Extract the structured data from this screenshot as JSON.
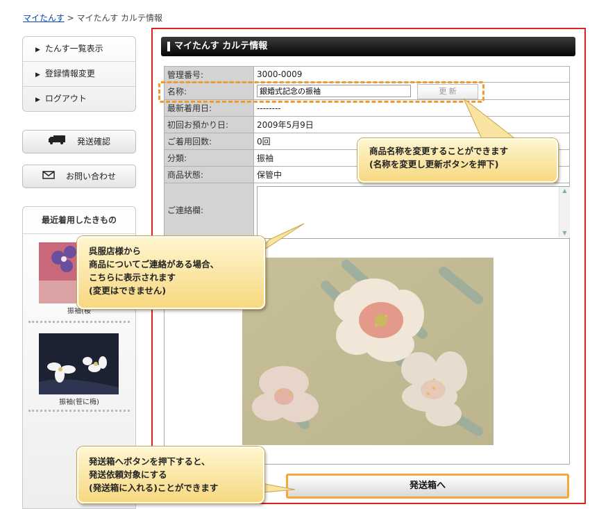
{
  "breadcrumb": {
    "home_link": "マイたんす",
    "separator": ">",
    "current": "マイたんす カルテ情報"
  },
  "sidebar": {
    "menu": [
      {
        "label": "たんす一覧表示"
      },
      {
        "label": "登録情報変更"
      },
      {
        "label": "ログアウト"
      }
    ],
    "shipping_confirm": "発送確認",
    "contact": "お問い合わせ",
    "recent": {
      "title": "最近着用したきもの",
      "items": [
        {
          "caption": "振袖(桜"
        },
        {
          "caption": "振袖(笹に梅)"
        }
      ]
    }
  },
  "page_title": "マイたんす カルテ情報",
  "details": {
    "management_no": {
      "label": "管理番号:",
      "value": "3000-0009"
    },
    "name": {
      "label": "名称:",
      "value": "銀婚式記念の振袖",
      "update_button": "更 新"
    },
    "last_worn": {
      "label": "最新着用日:",
      "value": "--------"
    },
    "first_deposit": {
      "label": "初回お預かり日:",
      "value": "2009年5月9日"
    },
    "wear_count": {
      "label": "ご着用回数:",
      "value": "0回"
    },
    "category": {
      "label": "分類:",
      "value": "振袖"
    },
    "status": {
      "label": "商品状態:",
      "value": "保管中"
    },
    "notes": {
      "label": "ご連絡欄:",
      "value": ""
    }
  },
  "send_button": "発送箱へ",
  "callouts": {
    "name_change": [
      "商品名称を変更することができます",
      "(名称を変更し更新ボタンを押下)"
    ],
    "contact_note": [
      "呉服店様から",
      "商品についてご連絡がある場合、",
      "こちらに表示されます",
      "(変更はできません)"
    ],
    "send_box": [
      "発送箱へボタンを押下すると、",
      "発送依頼対象にする",
      "(発送箱に入れる)ことができます"
    ]
  },
  "colors": {
    "frame_red": "#e0201a",
    "highlight_orange": "#f39a2e",
    "callout_fill": "#f6d880",
    "title_bar": "#111111"
  }
}
